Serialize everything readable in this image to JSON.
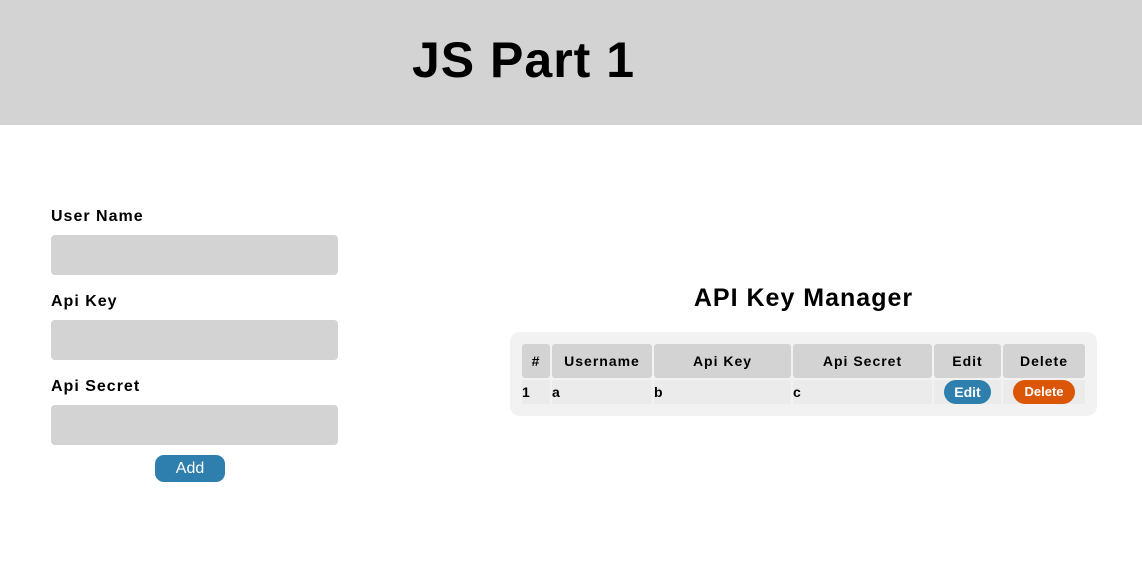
{
  "header": {
    "title": "JS Part 1"
  },
  "form": {
    "username_label": "User Name",
    "username_value": "",
    "apikey_label": "Api Key",
    "apikey_value": "",
    "apisecret_label": "Api Secret",
    "apisecret_value": "",
    "add_label": "Add"
  },
  "manager": {
    "title": "API Key Manager",
    "columns": [
      "#",
      "Username",
      "Api Key",
      "Api Secret",
      "Edit",
      "Delete"
    ],
    "rows": [
      {
        "num": "1",
        "username": "a",
        "api_key": "b",
        "api_secret": "c",
        "edit_label": "Edit",
        "delete_label": "Delete"
      }
    ]
  },
  "colors": {
    "header_bg": "#d3d3d3",
    "input_bg": "#d3d3d3",
    "primary_button": "#2e7fae",
    "delete_button": "#dc5608",
    "table_bg": "#f2f2f2"
  }
}
